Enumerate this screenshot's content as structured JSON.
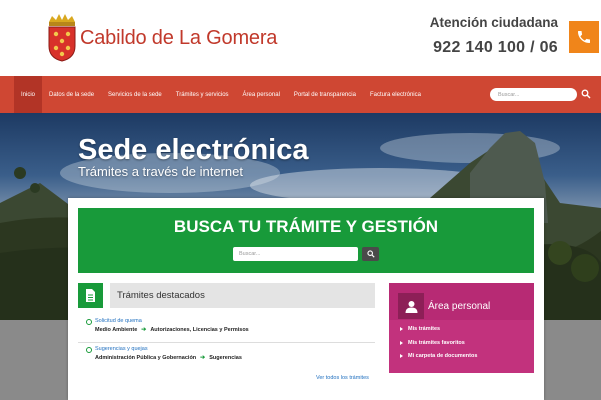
{
  "header": {
    "brand_name": "Cabildo de La Gomera",
    "attention_label": "Atención ciudadana",
    "phone_number": "922 140 100 / 06"
  },
  "nav": {
    "items": [
      {
        "label": "Inicio",
        "active": true
      },
      {
        "label": "Datos de la sede",
        "active": false
      },
      {
        "label": "Servicios de la sede",
        "active": false
      },
      {
        "label": "Trámites y servicios",
        "active": false
      },
      {
        "label": "Área personal",
        "active": false
      },
      {
        "label": "Portal de transparencia",
        "active": false
      },
      {
        "label": "Factura electrónica",
        "active": false
      }
    ],
    "search_placeholder": "Buscar..."
  },
  "hero": {
    "title": "Sede electrónica",
    "subtitle": "Trámites a través de internet"
  },
  "search_section": {
    "title": "BUSCA TU TRÁMITE Y GESTIÓN",
    "placeholder": "Buscar..."
  },
  "tramites": {
    "heading": "Trámites destacados",
    "items": [
      {
        "link": "Solicitud de quema",
        "category": "Medio Ambiente",
        "subcategory": "Autorizaciones, Licencias y Permisos"
      },
      {
        "link": "Sugerencias y quejas",
        "category": "Administración Pública y Gobernación",
        "subcategory": "Sugerencias"
      }
    ],
    "see_all": "Ver todos los trámites"
  },
  "area_personal": {
    "title": "Área personal",
    "items": [
      "Mis trámites",
      "Mis trámites favoritos",
      "Mi carpeta de documentos"
    ]
  },
  "colors": {
    "brand_red": "#cf4733",
    "accent_orange": "#f0851a",
    "green": "#189a3a",
    "magenta": "#c2327d"
  }
}
